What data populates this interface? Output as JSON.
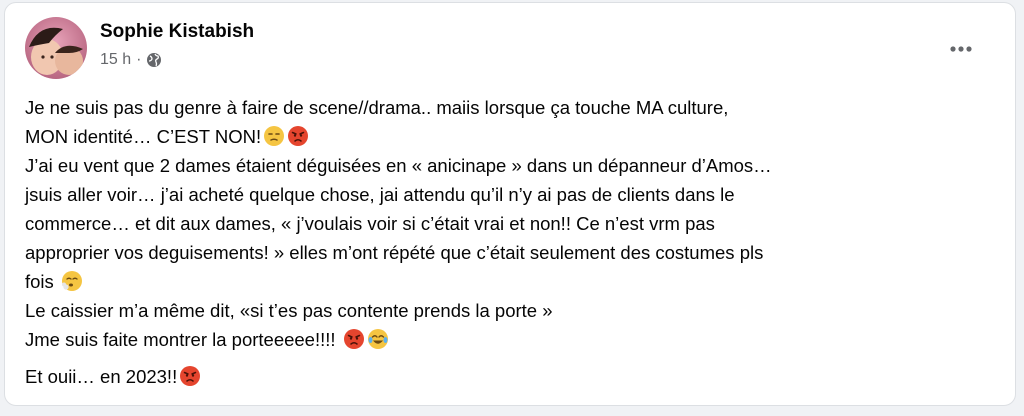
{
  "post": {
    "author": "Sophie Kistabish",
    "time": "15 h",
    "separator": "·",
    "privacy_icon": "globe-icon",
    "menu_icon": "more-options-icon",
    "lines": [
      "Je ne suis pas du genre à faire de scene//drama.. maiis lorsque ça touche MA culture,",
      "MON identité… C’EST NON!",
      "J’ai eu vent que 2 dames étaient déguisées en « anicinape » dans un dépanneur d’Amos…",
      "jsuis aller voir… j’ai acheté quelque chose, jai attendu qu’il n’y ai pas de clients dans le",
      "commerce… et dit aux dames, « j’voulais voir si c’était vrai et non!! Ce n’est vrm pas",
      "approprier vos deguisements! » elles m’ont répété que c’était seulement des costumes pls",
      "fois",
      "Le caissier m’a même dit, «si t’es pas contente prends la porte »",
      "Jme suis faite montrer la porteeeee!!!!",
      "Et ouii… en 2023!!"
    ],
    "emoji": {
      "line2": [
        "unamused-face",
        "angry-face"
      ],
      "line7": [
        "face-exhaling"
      ],
      "line9": [
        "angry-face",
        "tears-of-joy-face"
      ],
      "line10": [
        "angry-face"
      ]
    }
  }
}
